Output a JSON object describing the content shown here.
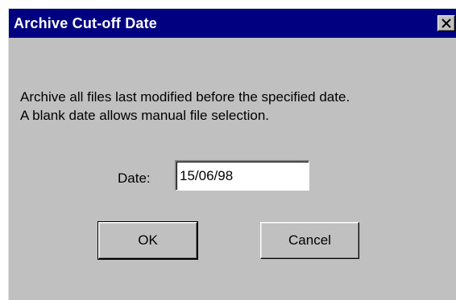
{
  "dialog": {
    "title": "Archive Cut-off Date",
    "close_icon": "close-icon",
    "message_line1": "Archive all files last modified before the specified date.",
    "message_line2": "A blank date allows manual file selection.",
    "date_label": "Date:",
    "date_value": "15/06/98",
    "ok_label": "OK",
    "cancel_label": "Cancel"
  },
  "colors": {
    "titlebar": "#000080",
    "face": "#c0c0c0",
    "title_text": "#ffffff"
  }
}
